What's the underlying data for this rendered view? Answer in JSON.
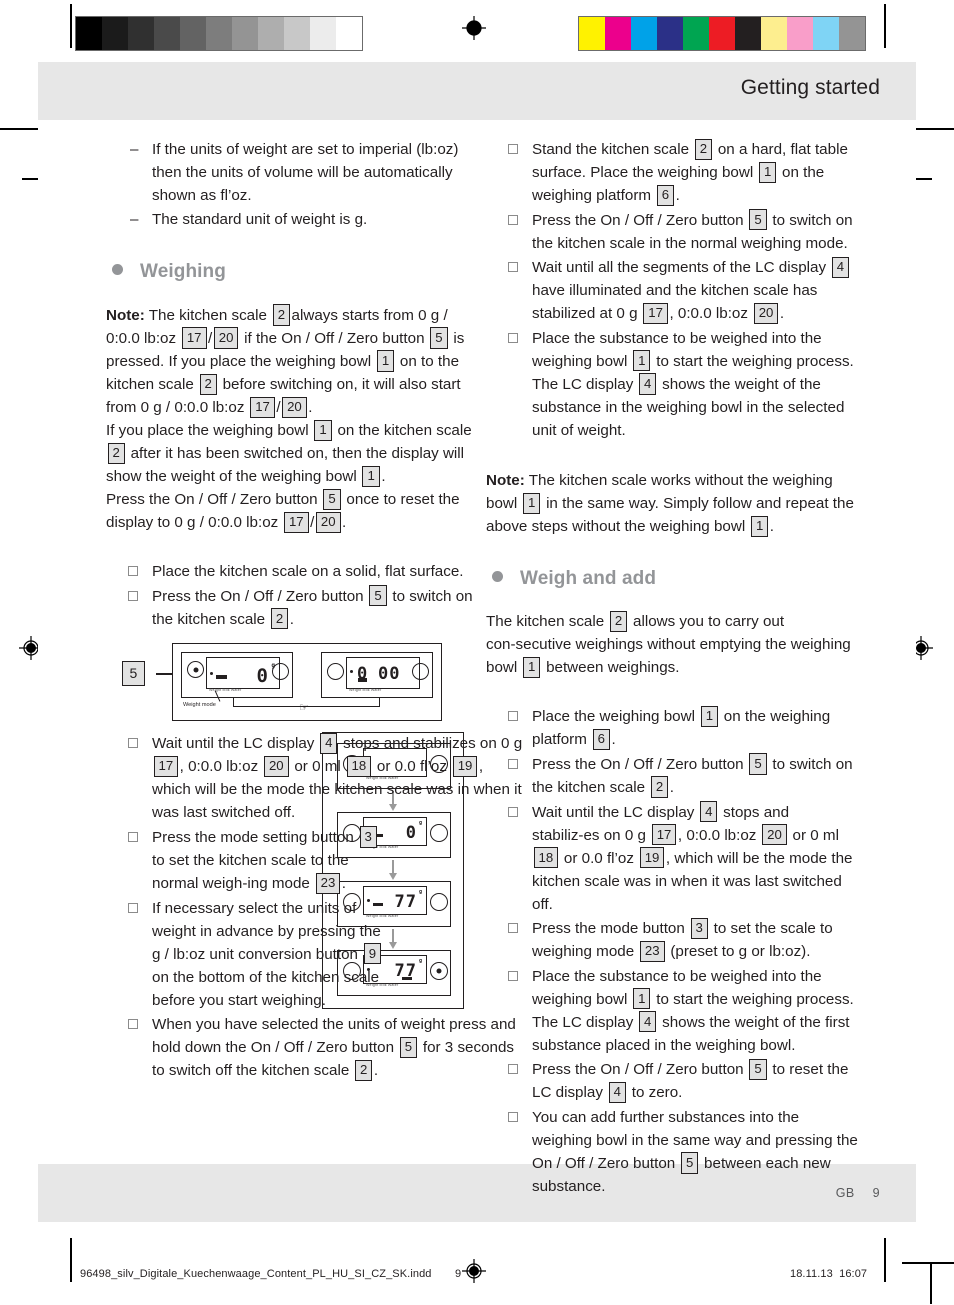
{
  "header": {
    "title": "Getting started"
  },
  "footer": {
    "locale": "GB",
    "page": "9"
  },
  "production": {
    "filename": "96498_silv_Digitale_Kuechenwaage_Content_PL_HU_SI_CZ_SK.indd",
    "page_marker": "9",
    "date": "18.11.13",
    "time": "16:07"
  },
  "left_column": {
    "intro_dashes": [
      {
        "pre": "If the units of weight are set to imperial (lb:oz) then the units of volume will be automatically shown as fl’oz."
      },
      {
        "pre": "The standard unit of weight is g."
      }
    ],
    "heading_weighing": "Weighing",
    "note": {
      "label": "Note:",
      "seg1": "The kitchen scale",
      "r1": "2",
      "seg2": "always starts from 0 g / 0:0.0 lb:oz",
      "r2": "17",
      "slash1": "/",
      "r3": "20",
      "seg3": "if the On / Off / Zero button",
      "r4": "5",
      "seg4": "is pressed. If you place the weighing bowl",
      "r5": "1",
      "seg5": "on to the kitchen scale",
      "r6": "2",
      "seg6": "before switching on, it will also start from 0 g / 0:0.0 lb:oz",
      "r7": "17",
      "slash2": "/",
      "r8": "20",
      "seg7": ".",
      "seg8": "If you place the weighing bowl",
      "r9": "1",
      "seg9": "on the kitchen scale",
      "r10": "2",
      "seg10": "after it has been switched on, then the display will show the weight of the weighing bowl",
      "r11": "1",
      "seg11": ".",
      "seg12": "Press the On / Off / Zero button",
      "r12": "5",
      "seg13": "once to reset the display to 0 g / 0:0.0 lb:oz",
      "r13": "17",
      "slash3": "/",
      "r14": "20",
      "seg14": "."
    },
    "steps_1": [
      {
        "t1": "Place the kitchen scale on a solid, flat surface."
      },
      {
        "t1": "Press the On / Off / Zero button",
        "r1": "5",
        "t2": "to switch on the kitchen scale",
        "r2": "2",
        "t3": "."
      }
    ],
    "fig_a": {
      "callout": "5",
      "weight_mode_label": "Weight mode",
      "display_1": "0",
      "display_1_unit": "g",
      "display_2_a": "0",
      "display_2_b": "00",
      "scale_labels": "Weight   Milk   Water"
    },
    "steps_2": [
      {
        "t1": "Wait until the LC display",
        "r1": "4",
        "t2": "stops and stabilizes on 0 g",
        "r2": "17",
        "t3": ", 0:0.0 lb:oz",
        "r3": "20",
        "t4": "or 0 ml",
        "r4": "18",
        "t5": "or 0.0 fl’oz",
        "r5": "19",
        "t6": ", which will be the mode the kitchen scale was in when it was last switched off."
      },
      {
        "t1": "Press the mode setting button",
        "r1": "3",
        "t2": "to set the kitchen scale to the normal weigh‑ing mode",
        "r2": "23",
        "t3": "."
      },
      {
        "t1": "If necessary select the units of weight in advance by pressing the g / lb:oz unit conversion button",
        "r1": "9",
        "t2": "on the bottom of the kitchen scale before you start weighing."
      },
      {
        "t1": "When you have selected the units of weight press and hold down the On / Off / Zero button",
        "r1": "5",
        "t2": "for 3 seconds to switch off the kitchen scale",
        "r2": "2",
        "t3": "."
      }
    ],
    "fig_b": {
      "steps": [
        {
          "value": "",
          "unit": ""
        },
        {
          "value": "0",
          "unit": "g"
        },
        {
          "value": "77",
          "unit": "g"
        },
        {
          "value": "77",
          "unit": "g"
        }
      ],
      "scale_labels": "Weight   Milk   Water"
    }
  },
  "right_column": {
    "steps_1": [
      {
        "t1": "Stand the kitchen scale",
        "r1": "2",
        "t2": "on a hard, flat table surface. Place the weighing bowl",
        "r2": "1",
        "t3": "on the weighing platform",
        "r3": "6",
        "t4": "."
      },
      {
        "t1": "Press the On / Off / Zero button",
        "r1": "5",
        "t2": "to switch on the kitchen scale in the normal weighing mode."
      },
      {
        "t1": "Wait until all the segments of the LC display",
        "r1": "4",
        "t2": "have illuminated and the kitchen scale has stabilized at 0 g",
        "r2": "17",
        "t3": ", 0:0.0 lb:oz",
        "r3": "20",
        "t4": "."
      },
      {
        "t1": "Place the substance to be weighed into the weighing bowl",
        "r1": "1",
        "t2": "to start the weighing process. The LC display",
        "r2": "4",
        "t3": "shows the weight of the substance in the weighing bowl in the selected unit of weight."
      }
    ],
    "note": {
      "label": "Note:",
      "seg1": "The kitchen scale works without the weighing bowl",
      "r1": "1",
      "seg2": "in the same way. Simply follow and repeat the above steps without the weighing bowl",
      "r2": "1",
      "seg3": "."
    },
    "heading_weigh_and_add": "Weigh and add",
    "intro": {
      "seg1": "The kitchen scale",
      "r1": "2",
      "seg2": "allows you to carry out con‑secutive weighings without emptying the weighing bowl",
      "r2": "1",
      "seg3": "between weighings."
    },
    "steps_2": [
      {
        "t1": "Place the weighing bowl",
        "r1": "1",
        "t2": "on the weighing platform",
        "r2": "6",
        "t3": "."
      },
      {
        "t1": "Press the On / Off / Zero button",
        "r1": "5",
        "t2": "to switch on the kitchen scale",
        "r2": "2",
        "t3": "."
      },
      {
        "t1": "Wait until the LC display",
        "r1": "4",
        "t2": "stops and stabiliz‑es on 0 g",
        "r2": "17",
        "t3": ", 0:0.0 lb:oz",
        "r3": "20",
        "t4": "or 0 ml",
        "r4": "18",
        "t5": "or 0.0 fl’oz",
        "r5": "19",
        "t6": ", which will be the mode the kitchen scale was in when it was last switched off."
      },
      {
        "t1": "Press the mode button",
        "r1": "3",
        "t2": "to set the scale to weighing mode",
        "r2": "23",
        "t3": "(preset to g or lb:oz)."
      },
      {
        "t1": "Place the substance to be weighed into the weighing bowl",
        "r1": "1",
        "t2": "to start the weighing process. The LC display",
        "r2": "4",
        "t3": "shows the weight of the first substance placed in the weighing bowl."
      },
      {
        "t1": "Press the On / Off / Zero button",
        "r1": "5",
        "t2": "to reset the LC display",
        "r2": "4",
        "t3": "to zero."
      },
      {
        "t1": "You can add further substances into the weighing bowl in the same way and pressing the On / Off / Zero button",
        "r1": "5",
        "t2": "between each new substance."
      }
    ]
  },
  "colors": {
    "grayscale_bar": [
      "#000000",
      "#1b1b1b",
      "#303030",
      "#4a4a4a",
      "#636363",
      "#7d7d7d",
      "#949494",
      "#aeaeae",
      "#c8c8c8",
      "#ececec",
      "#ffffff"
    ],
    "color_bar": [
      "#fff200",
      "#ec008c",
      "#00a2e8",
      "#2b3087",
      "#00a551",
      "#ed1c24",
      "#231f20",
      "#fdee8f",
      "#f99ec9",
      "#7fd4f5",
      "#949494"
    ],
    "heading_gray": "#939598",
    "band_gray": "#e7e7e7",
    "ref_fill": "#e2e2e2",
    "text": "#231f20"
  }
}
